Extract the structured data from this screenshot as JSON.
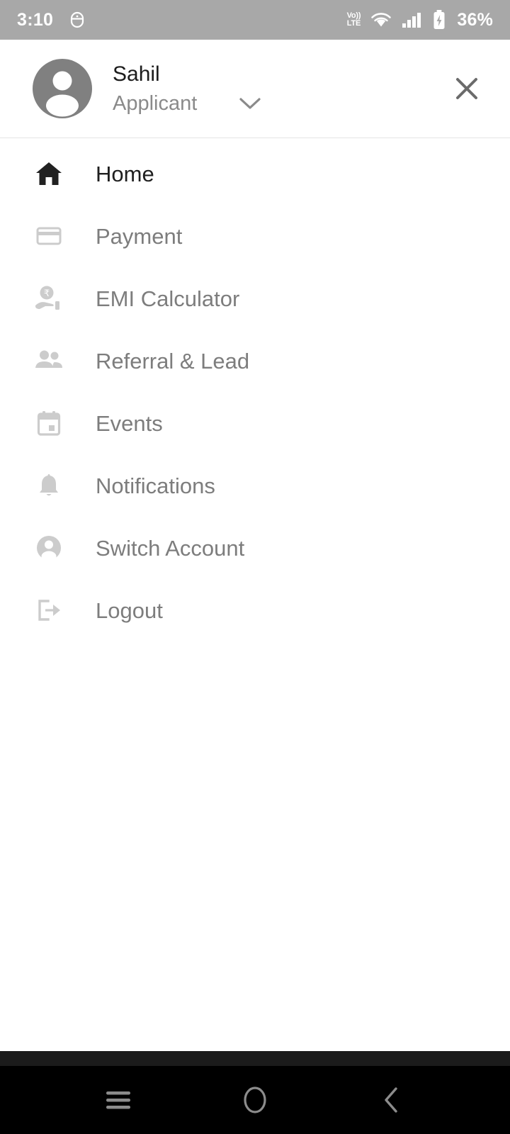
{
  "status_bar": {
    "time": "3:10",
    "notification_icon": "android-notification-icon",
    "network_label_top": "VoLTE",
    "volte_top": "Vo))",
    "volte_bottom": "LTE",
    "wifi_icon": "wifi-icon",
    "signal_icon": "cellular-signal-icon",
    "battery_icon": "battery-charging-icon",
    "battery_percent": "36%",
    "background_color": "#a8a8a8",
    "foreground_color": "#ffffff"
  },
  "drawer": {
    "avatar_icon": "user-avatar-icon",
    "user_name": "Sahil",
    "user_role": "Applicant",
    "role_chevron_icon": "chevron-down-icon",
    "close_icon": "close-icon",
    "menu_items": [
      {
        "label": "Home",
        "icon": "home-icon",
        "active": true
      },
      {
        "label": "Payment",
        "icon": "credit-card-icon",
        "active": false
      },
      {
        "label": "EMI Calculator",
        "icon": "hand-rupee-coin-icon",
        "active": false
      },
      {
        "label": "Referral & Lead",
        "icon": "people-group-icon",
        "active": false
      },
      {
        "label": "Events",
        "icon": "calendar-icon",
        "active": false
      },
      {
        "label": "Notifications",
        "icon": "bell-icon",
        "active": false
      },
      {
        "label": "Switch Account",
        "icon": "account-circle-icon",
        "active": false
      },
      {
        "label": "Logout",
        "icon": "logout-icon",
        "active": false
      }
    ]
  },
  "navigation_bar": {
    "recents_icon": "recents-menu-icon",
    "home_icon": "home-circle-icon",
    "back_icon": "back-chevron-icon",
    "background_color": "#000000",
    "icon_color": "#8c8c8c"
  },
  "colors": {
    "active_text": "#1f1f1f",
    "inactive_text": "#7d7d7d",
    "icon_inactive": "#cccccc",
    "icon_active": "#212121",
    "avatar_gray": "#808080",
    "divider": "#e4e4e4"
  }
}
